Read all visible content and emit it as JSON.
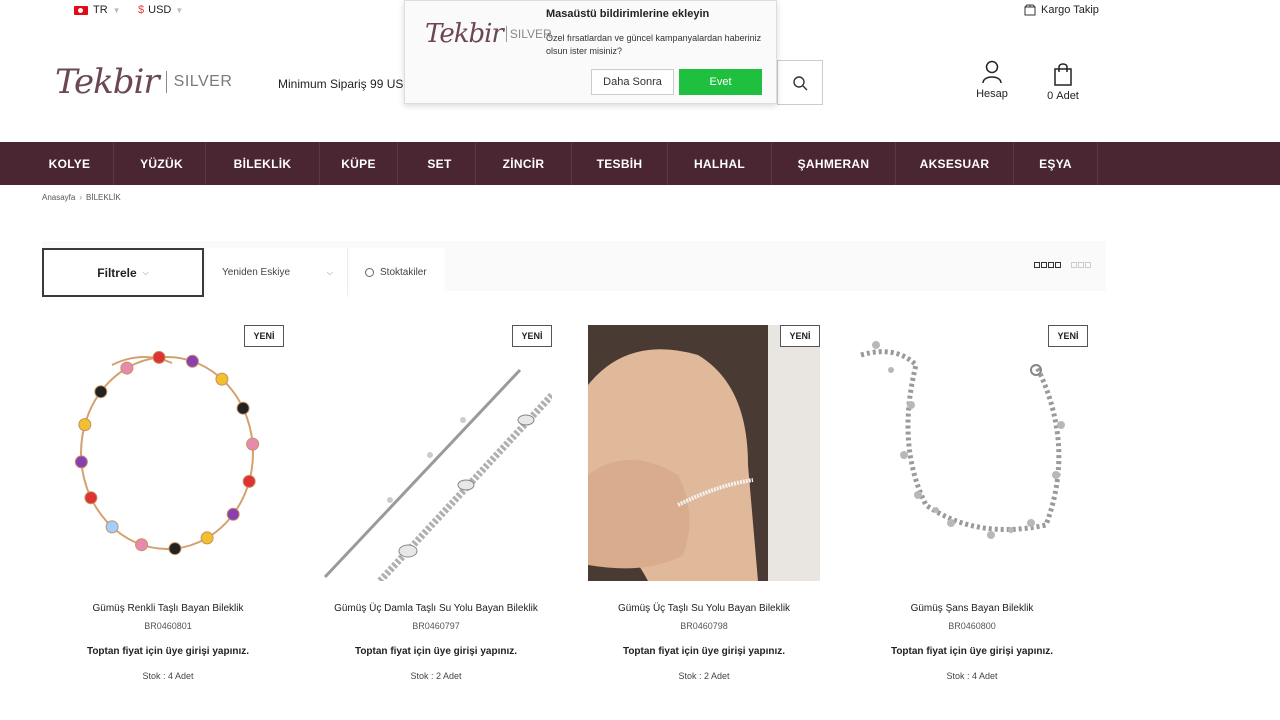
{
  "topbar": {
    "language": "TR",
    "currency_symbol": "$",
    "currency": "USD",
    "cargo_track": "Kargo Takip"
  },
  "brand": {
    "script": "Tekbir",
    "word": "SILVER"
  },
  "header": {
    "min_order": "Minimum Sipariş 99 US",
    "account_label": "Hesap",
    "cart_count": "0",
    "cart_label": "Adet"
  },
  "popup": {
    "title": "Masaüstü bildirimlerine ekleyin",
    "body": "Özel fırsatlardan ve güncel kampanyalardan haberiniz olsun ister misiniz?",
    "later_label": "Daha Sonra",
    "yes_label": "Evet",
    "yes_color": "#1fbf3f"
  },
  "nav": {
    "items": [
      "KOLYE",
      "YÜZÜK",
      "BİLEKLİK",
      "KÜPE",
      "SET",
      "ZİNCİR",
      "TESBİH",
      "HALHAL",
      "ŞAHMERAN",
      "AKSESUAR",
      "EŞYA"
    ],
    "background": "#4a2632"
  },
  "breadcrumb": {
    "home": "Anasayfa",
    "separator": "›",
    "current": "BİLEKLİK"
  },
  "toolbar": {
    "filter_label": "Filtrele",
    "sort_label": "Yeniden Eskiye",
    "stock_label": "Stoktakiler"
  },
  "products": [
    {
      "badge": "YENİ",
      "name": "Gümüş Renkli Taşlı Bayan Bileklik",
      "code": "BR0460801",
      "price_note": "Toptan fiyat için üye girişi yapınız.",
      "stock": "Stok : 4 Adet",
      "image": "colorful-stone-bracelet"
    },
    {
      "badge": "YENİ",
      "name": "Gümüş Üç Damla Taşlı Su Yolu Bayan Bileklik",
      "code": "BR0460797",
      "price_note": "Toptan fiyat için üye girişi yapınız.",
      "stock": "Stok : 2 Adet",
      "image": "drop-stone-tennis-bracelet"
    },
    {
      "badge": "YENİ",
      "name": "Gümüş Üç Taşlı Su Yolu Bayan Bileklik",
      "code": "BR0460798",
      "price_note": "Toptan fiyat için üye girişi yapınız.",
      "stock": "Stok : 2 Adet",
      "image": "bracelet-on-wrist"
    },
    {
      "badge": "YENİ",
      "name": "Gümüş Şans Bayan Bileklik",
      "code": "BR0460800",
      "price_note": "Toptan fiyat için üye girişi yapınız.",
      "stock": "Stok : 4 Adet",
      "image": "charm-bracelet"
    }
  ]
}
